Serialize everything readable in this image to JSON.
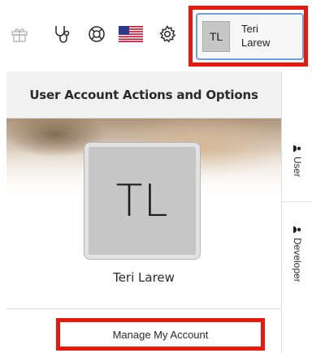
{
  "toolbar": {
    "icons": [
      {
        "name": "gift-icon"
      },
      {
        "name": "stethoscope-icon"
      },
      {
        "name": "lifebuoy-icon"
      },
      {
        "name": "us-flag-icon"
      },
      {
        "name": "gear-icon"
      }
    ],
    "user_button": {
      "initials": "TL",
      "first_name": "Teri",
      "last_name": "Larew"
    }
  },
  "panel": {
    "title": "User Account Actions and Options",
    "profile": {
      "initials": "TL",
      "name": "Teri Larew"
    },
    "manage_link": "Manage My Account"
  },
  "side_tabs": [
    {
      "label": "User"
    },
    {
      "label": "Developer"
    }
  ],
  "colors": {
    "highlight": "#e8180c",
    "button_border": "#6f9fe0",
    "avatar_bg": "#c6c6c6"
  }
}
